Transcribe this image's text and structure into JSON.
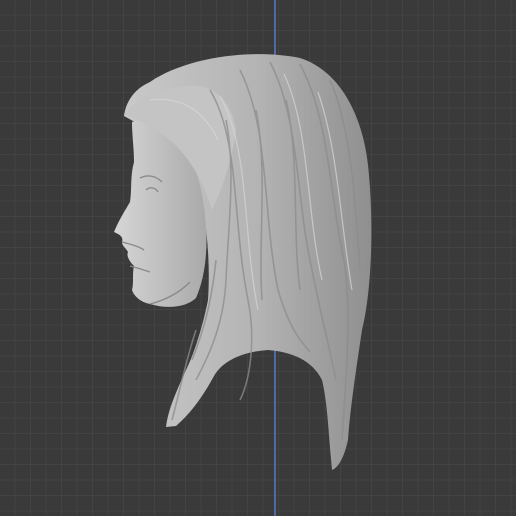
{
  "viewport": {
    "background_color": "#3a3a3a",
    "grid_color": "#434343",
    "axis_color": "#4f6fa8",
    "axis": "z-axis",
    "model": {
      "type": "sculpted-head-bust",
      "view": "side-profile-left",
      "material_color": "#bdbdbd"
    }
  }
}
